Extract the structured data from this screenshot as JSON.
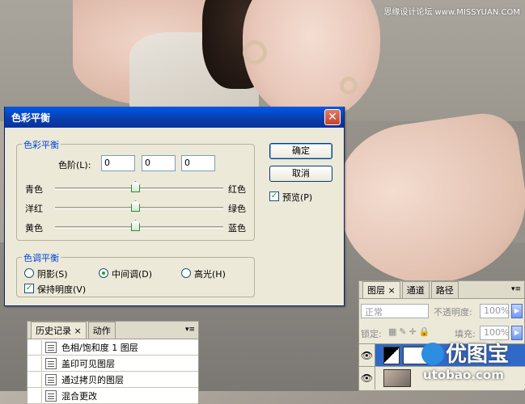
{
  "watermark": "思缘设计论坛 www.MISSYUAN.COM",
  "dialog": {
    "title": "色彩平衡",
    "color_balance_group": "色彩平衡",
    "levels_label": "色阶(L):",
    "levels": [
      "0",
      "0",
      "0"
    ],
    "sliders": [
      {
        "left": "青色",
        "right": "红色",
        "value": 0
      },
      {
        "left": "洋红",
        "right": "绿色",
        "value": 0
      },
      {
        "left": "黄色",
        "right": "蓝色",
        "value": 0
      }
    ],
    "tone_group": "色调平衡",
    "tones": [
      {
        "label": "阴影(S)",
        "selected": false
      },
      {
        "label": "中间调(D)",
        "selected": true
      },
      {
        "label": "高光(H)",
        "selected": false
      }
    ],
    "preserve_luminosity": "保持明度(V)",
    "ok": "确定",
    "cancel": "取消",
    "preview": "预览(P)"
  },
  "history": {
    "tabs": [
      "历史记录",
      "动作"
    ],
    "items": [
      "色相/饱和度 1 图层",
      "盖印可见图层",
      "通过拷贝的图层",
      "混合更改"
    ]
  },
  "layers": {
    "tabs": [
      "图层",
      "通道",
      "路径"
    ],
    "blend_mode": "正常",
    "opacity_label": "不透明度:",
    "opacity": "100%",
    "lock_label": "锁定:",
    "fill_label": "填充:",
    "fill": "100%"
  },
  "logo": {
    "text": "优图宝",
    "url": "utobao.com"
  }
}
